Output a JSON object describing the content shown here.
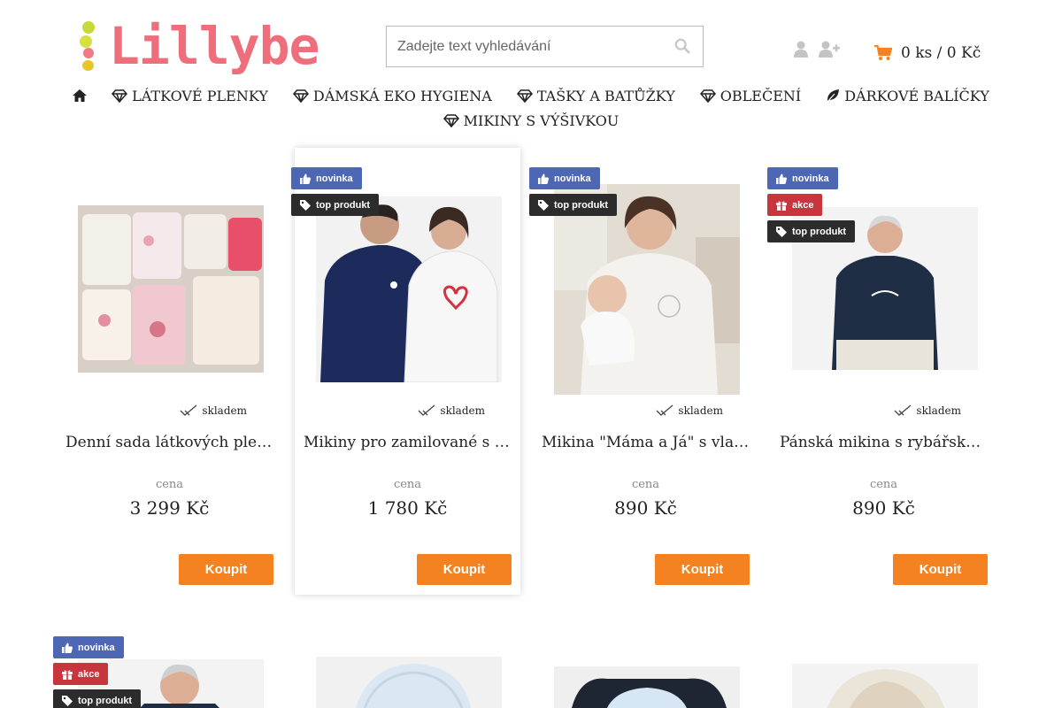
{
  "header": {
    "logo_text": "Lillybe",
    "search_placeholder": "Zadejte text vyhledávání",
    "cart_text": "0 ks / 0 Kč"
  },
  "nav": [
    {
      "icon": "home-icon",
      "label": ""
    },
    {
      "icon": "diamond-icon",
      "label": "LÁTKOVÉ PLENKY"
    },
    {
      "icon": "diamond-icon",
      "label": "DÁMSKÁ EKO HYGIENA"
    },
    {
      "icon": "diamond-icon",
      "label": "TAŠKY A BATŮŽKY"
    },
    {
      "icon": "diamond-icon",
      "label": "OBLEČENÍ"
    },
    {
      "icon": "leaf-icon",
      "label": "DÁRKOVÉ BALÍČKY"
    },
    {
      "icon": "diamond-icon",
      "label": "MIKINY S VÝŠIVKOU"
    }
  ],
  "labels": {
    "novinka": "novinka",
    "top": "top produkt",
    "akce": "akce",
    "stock": "skladem",
    "price_label": "cena",
    "buy": "Koupit"
  },
  "products": [
    {
      "name": "Denní sada látkových plen, …",
      "price": "3 299 Kč"
    },
    {
      "name": "Mikiny pro zamilované s vla…",
      "price": "1 780 Kč"
    },
    {
      "name": "Mikina \"Máma a Já\" s vlastní…",
      "price": "890 Kč"
    },
    {
      "name": "Pánská mikina s rybářskou v…",
      "price": "890 Kč"
    }
  ],
  "colors": {
    "accent": "#f58220",
    "logo": "#ee6f7b",
    "badge_new": "#4d67b5",
    "badge_top": "#2c2c2c",
    "badge_sale": "#c7353d"
  }
}
